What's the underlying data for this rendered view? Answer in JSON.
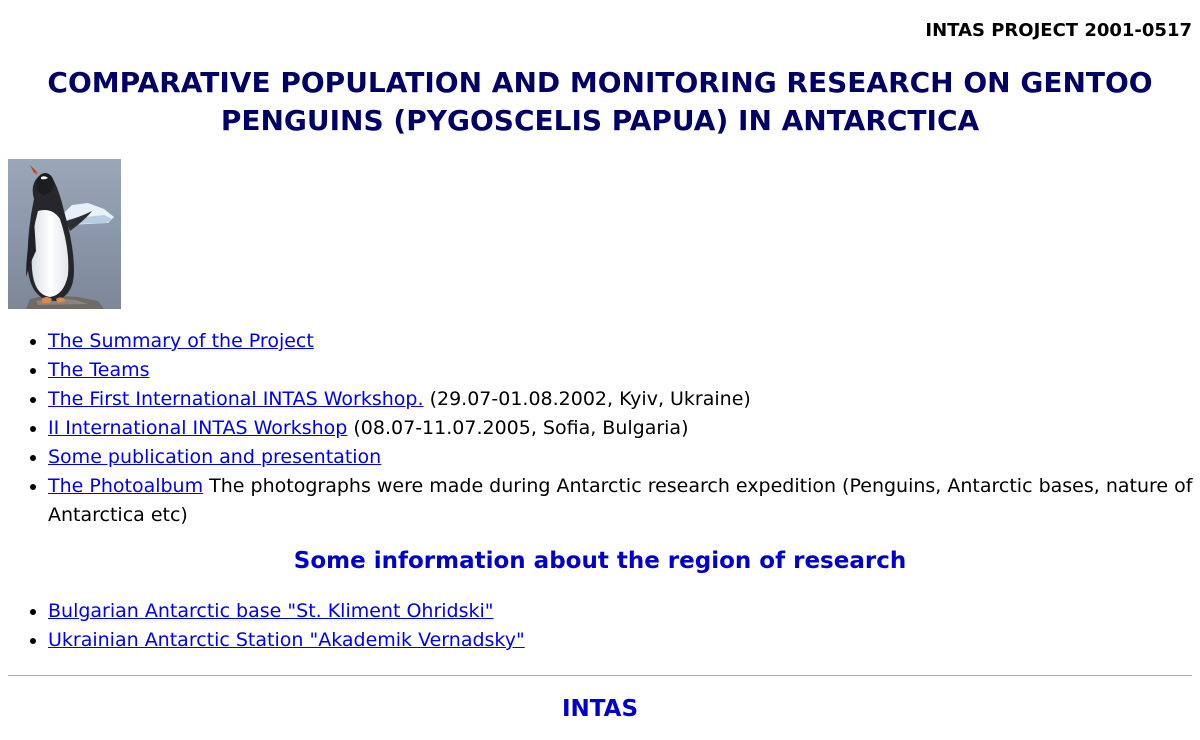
{
  "header": {
    "project_id": "INTAS PROJECT 2001-0517",
    "title": "COMPARATIVE POPULATION AND MONITORING RESEARCH ON GENTOO PENGUINS (PYGOSCELIS PAPUA) IN ANTARCTICA"
  },
  "photo": {
    "icon": "gentoo-penguin-photo"
  },
  "main_links": [
    {
      "label": "The Summary of the Project",
      "note": ""
    },
    {
      "label": "The Teams",
      "note": ""
    },
    {
      "label": "The First International INTAS Workshop.",
      "note": " (29.07-01.08.2002, Kyiv, Ukraine)"
    },
    {
      "label": "II International INTAS Workshop",
      "note": " (08.07-11.07.2005, Sofia, Bulgaria)"
    },
    {
      "label": "Some publication and presentation",
      "note": ""
    },
    {
      "label": "The Photoalbum",
      "note": " The photographs were made during Antarctic research expedition (Penguins, Antarctic bases, nature of Antarctica etc)"
    }
  ],
  "region": {
    "title": "Some information about the region of research",
    "links": [
      {
        "label": "Bulgarian Antarctic base \"St. Kliment Ohridski\""
      },
      {
        "label": "Ukrainian Antarctic Station \"Akademik Vernadsky\""
      }
    ]
  },
  "footer": {
    "title": "INTAS"
  },
  "colors": {
    "title": "#000066",
    "section": "#0000cc",
    "link": "#0000ee"
  }
}
